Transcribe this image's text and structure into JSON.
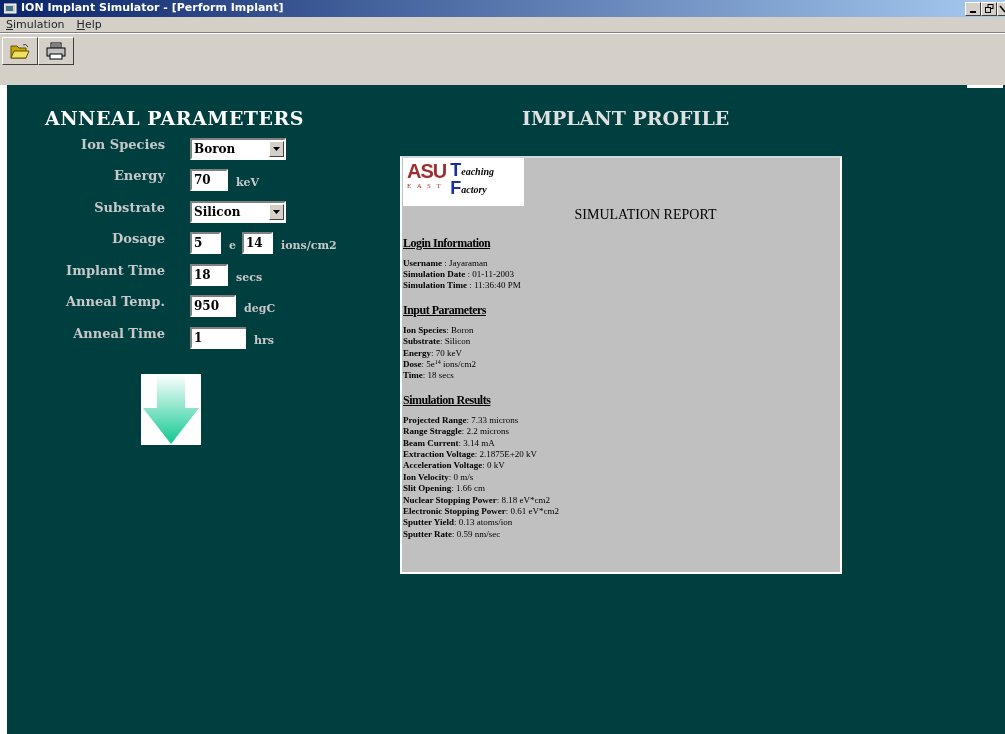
{
  "window": {
    "title": "ION Implant Simulator - [Perform Implant]"
  },
  "menu": [
    "Simulation",
    "Help"
  ],
  "toolbar": [
    {
      "kind": "open"
    },
    {
      "kind": "print"
    }
  ],
  "anneal_parameters": {
    "title": "ANNEAL PARAMETERS",
    "fields": [
      {
        "label": "Ion Species",
        "kind": "select",
        "value": "Boron"
      },
      {
        "label": "Energy",
        "kind": "text",
        "value": "70",
        "unit": "keV"
      },
      {
        "label": "Substrate",
        "kind": "select",
        "value": "Silicon"
      },
      {
        "label": "Dosage",
        "kind": "dose",
        "value": "5",
        "separator": "e",
        "exponent": "14",
        "unit": "ions/cm2"
      },
      {
        "label": "Implant Time",
        "kind": "text",
        "value": "18",
        "unit": "secs"
      },
      {
        "label": "Anneal Temp.",
        "kind": "text",
        "value": "950",
        "unit": "degC"
      },
      {
        "label": "Anneal Time",
        "kind": "wide",
        "value": "1",
        "unit": "hrs"
      }
    ]
  },
  "implant_profile": {
    "title": "IMPLANT PROFILE",
    "logo": {
      "left_top": "ASU",
      "left_bottom": "E A S T",
      "right_top": "eaching",
      "right_bottom": "actory",
      "letter_top": "T",
      "letter_bottom": "F"
    },
    "report_title": "SIMULATION REPORT",
    "sections": [
      {
        "heading": "Login Information",
        "lines": [
          "**Username** : Jayaraman",
          "**Simulation Date** : 01-11-2003",
          "**Simulation Time** : 11:36:40 PM"
        ]
      },
      {
        "heading": "Input Parameters",
        "lines": [
          "**Ion Species**: Boron",
          "**Substrate**: Silicon",
          "**Energy**: 70 keV",
          "**Dose**: 5e$^{14}$ ions/cm2",
          "**Time**: 18 secs"
        ]
      },
      {
        "heading": "Simulation Results",
        "lines": [
          "**Projected Range**: 7.33 microns",
          "**Range Straggle**: 2.2 microns",
          "**Beam Current**: 3.14 mA",
          "**Extraction Voltage**: 2.1875E+20 kV",
          "**Acceleration Voltage**: 0 kV",
          "**Ion Velocity**: 0 m/s",
          "**Slit Opening**: 1.66 cm",
          "**Nuclear Stopping Power**: 8.18 eV*cm2",
          "**Electronic Stopping Power**: 0.61 eV*cm2",
          "**Sputter Yield**: 0.13 atoms/ion",
          "**Sputter Rate**: 0.59 nm/sec"
        ]
      }
    ]
  }
}
